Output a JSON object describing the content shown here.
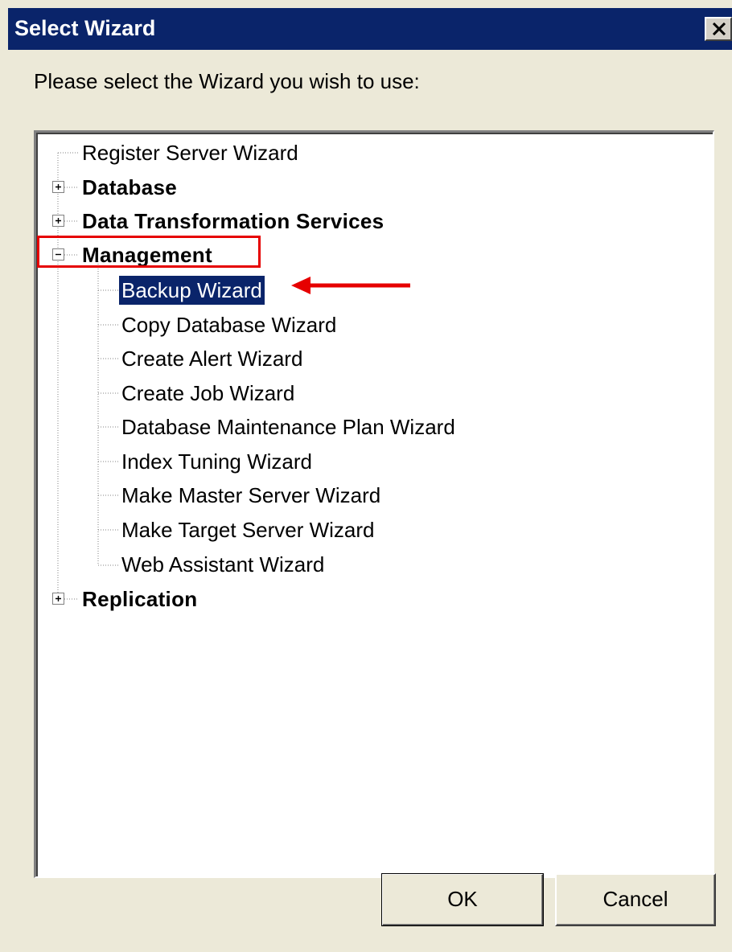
{
  "dialog": {
    "title": "Select Wizard",
    "close_icon": "close-icon",
    "instruction": "Please select the Wizard you wish to use:"
  },
  "tree": {
    "items": [
      {
        "label": "Register Server Wizard",
        "type": "leaf"
      },
      {
        "label": "Database",
        "type": "group",
        "expanded": false
      },
      {
        "label": "Data Transformation Services",
        "type": "group",
        "expanded": false
      },
      {
        "label": "Management",
        "type": "group",
        "expanded": true
      },
      {
        "label": "Replication",
        "type": "group",
        "expanded": false
      }
    ],
    "management_children": [
      {
        "label": "Backup Wizard",
        "selected": true
      },
      {
        "label": "Copy Database Wizard"
      },
      {
        "label": "Create Alert Wizard"
      },
      {
        "label": "Create Job Wizard"
      },
      {
        "label": "Database Maintenance Plan Wizard"
      },
      {
        "label": "Index Tuning Wizard"
      },
      {
        "label": "Make Master Server Wizard"
      },
      {
        "label": "Make Target Server Wizard"
      },
      {
        "label": "Web Assistant Wizard"
      }
    ],
    "expand_icon": "plus-icon",
    "collapse_icon": "minus-icon"
  },
  "annotation": {
    "highlight_color": "#e60000",
    "arrow_icon": "red-arrow-icon"
  },
  "buttons": {
    "ok": "OK",
    "cancel": "Cancel"
  },
  "colors": {
    "titlebar": "#0a246a",
    "dialog_bg": "#ece9d8",
    "selection": "#0a246a"
  }
}
